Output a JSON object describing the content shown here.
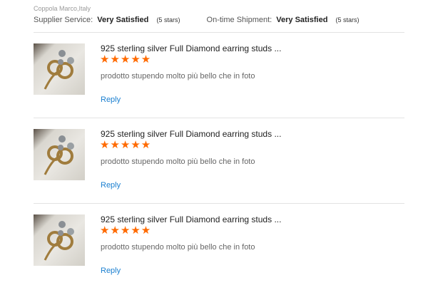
{
  "reviewer": "Coppola Marco,Italy",
  "ratings": [
    {
      "label": "Supplier Service:",
      "value": "Very Satisfied",
      "stars_note": "(5 stars)"
    },
    {
      "label": "On-time Shipment:",
      "value": "Very Satisfied",
      "stars_note": "(5 stars)"
    }
  ],
  "reviews": [
    {
      "product_title": "925 sterling silver Full Diamond earring studs ...",
      "stars": "★★★★★",
      "rating": 5,
      "comment": "prodotto stupendo molto più bello che in foto",
      "reply_label": "Reply"
    },
    {
      "product_title": "925 sterling silver Full Diamond earring studs ...",
      "stars": "★★★★★",
      "rating": 5,
      "comment": "prodotto stupendo molto più bello che in foto",
      "reply_label": "Reply"
    },
    {
      "product_title": "925 sterling silver Full Diamond earring studs ...",
      "stars": "★★★★★",
      "rating": 5,
      "comment": "prodotto stupendo molto più bello che in foto",
      "reply_label": "Reply"
    }
  ],
  "colors": {
    "star": "#ff6a00",
    "link": "#1a7fd0"
  }
}
